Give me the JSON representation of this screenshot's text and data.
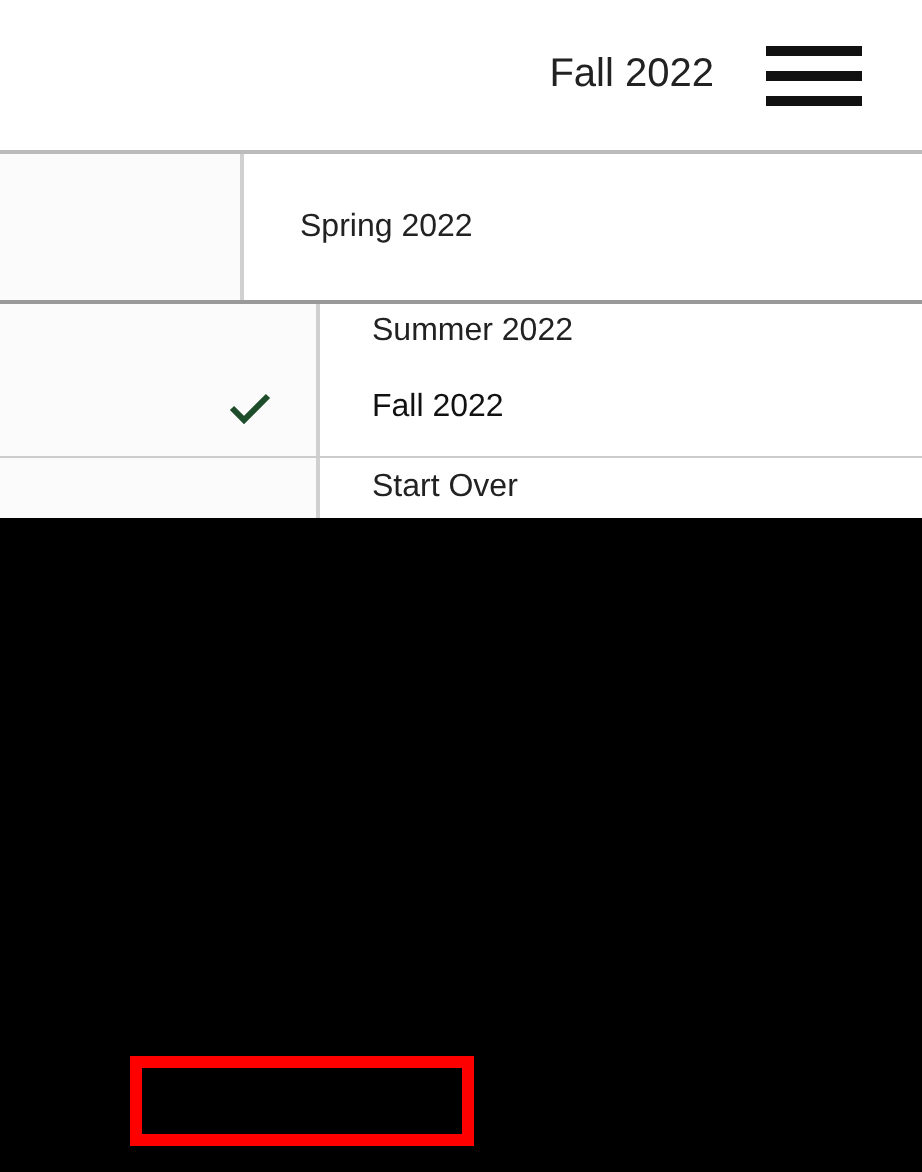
{
  "header": {
    "term": "Fall 2022"
  },
  "menu": {
    "items": [
      {
        "label": "Spring 2022",
        "selected": false
      },
      {
        "label": "Summer 2022",
        "selected": false
      },
      {
        "label": "Fall 2022",
        "selected": true
      },
      {
        "label": "Start Over",
        "selected": false
      }
    ]
  }
}
